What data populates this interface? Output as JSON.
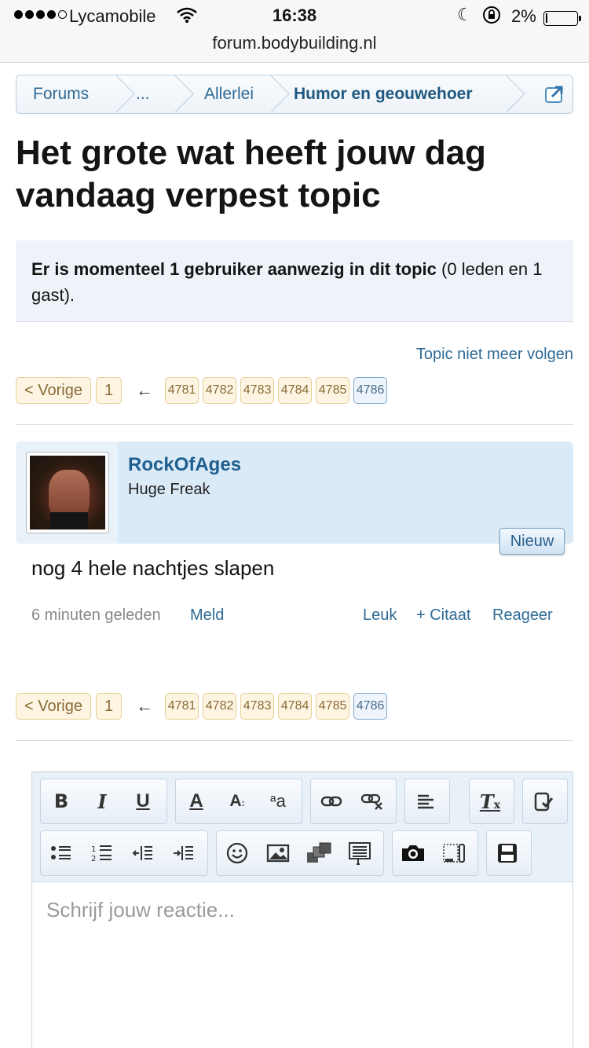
{
  "status_bar": {
    "carrier": "Lycamobile",
    "time": "16:38",
    "battery": "2%"
  },
  "browser": {
    "url": "forum.bodybuilding.nl"
  },
  "breadcrumb": {
    "items": [
      "Forums",
      "...",
      "Allerlei",
      "Humor en geouwehoer"
    ]
  },
  "topic": {
    "title": "Het grote wat heeft jouw dag vandaag verpest topic",
    "notice_bold": "Er is momenteel 1 gebruiker aanwezig in dit topic",
    "notice_rest": " (0 leden en 1 gast).",
    "follow_link": "Topic niet meer volgen"
  },
  "pagination": {
    "prev_label": "< Vorige",
    "first": "1",
    "jump_arrow": "←",
    "pages": [
      "4781",
      "4782",
      "4783",
      "4784",
      "4785",
      "4786"
    ],
    "current": "4786"
  },
  "post": {
    "username": "RockOfAges",
    "user_title": "Huge Freak",
    "badge": "Nieuw",
    "body": "nog 4 hele nachtjes slapen",
    "time_ago": "6 minuten geleden",
    "report": "Meld",
    "like": "Leuk",
    "quote": "+ Citaat",
    "reply": "Reageer"
  },
  "editor": {
    "placeholder": "Schrijf jouw reactie...",
    "toolbar_row1": [
      "bold-icon",
      "italic-icon",
      "underline-icon",
      "font-color-icon",
      "font-size-icon",
      "text-size-icon",
      "link-icon",
      "unlink-icon",
      "align-icon",
      "remove-format-icon",
      "paste-icon"
    ],
    "toolbar_row2": [
      "bullet-list-icon",
      "number-list-icon",
      "outdent-icon",
      "indent-icon",
      "smiley-icon",
      "image-icon",
      "media-icon",
      "template-icon",
      "camera-icon",
      "resize-icon",
      "save-icon"
    ]
  },
  "colors": {
    "link": "#2f6b96",
    "post_header_bg": "#dbeaf7",
    "page_button_bg": "#fdf5e2",
    "notice_bg": "#eef3f9"
  }
}
